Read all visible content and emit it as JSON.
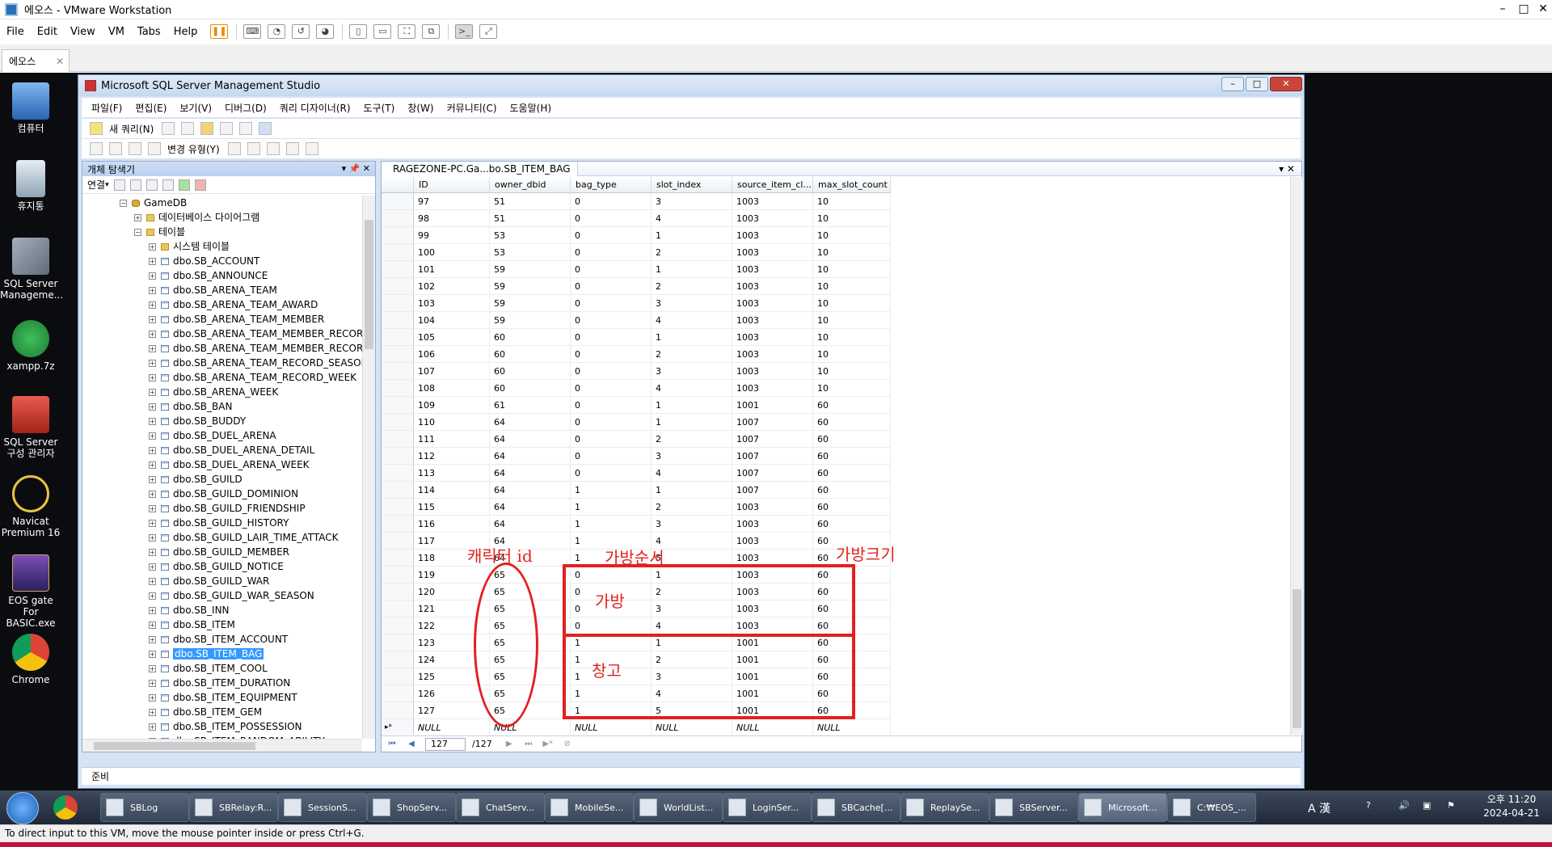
{
  "vm": {
    "title": "에오스 - VMware Workstation",
    "menu": [
      "File",
      "Edit",
      "View",
      "VM",
      "Tabs",
      "Help"
    ],
    "tab_label": "에오스",
    "status_text": "To direct input to this VM, move the mouse pointer inside or press Ctrl+G."
  },
  "desktop_icons": [
    "컴퓨터",
    "휴지통",
    "SQL Server Manageme...",
    "xampp.7z",
    "SQL Server 구성 관리자",
    "Navicat Premium 16",
    "EOS gate For BASIC.exe ...",
    "Chrome"
  ],
  "ssms": {
    "title": "Microsoft SQL Server Management Studio",
    "menu": [
      "파일(F)",
      "편집(E)",
      "보기(V)",
      "디버그(D)",
      "쿼리 디자이너(R)",
      "도구(T)",
      "창(W)",
      "커뮤니티(C)",
      "도움말(H)"
    ],
    "new_query": "새 쿼리(N)",
    "change_type": "변경 유형(Y)",
    "status": "준비"
  },
  "object_explorer": {
    "title": "개체 탐색기",
    "connect": "연결",
    "db_name": "GameDB",
    "diagrams": "데이터베이스 다이어그램",
    "tables_folder": "테이블",
    "system_tables": "시스템 테이블",
    "tables": [
      "dbo.SB_ACCOUNT",
      "dbo.SB_ANNOUNCE",
      "dbo.SB_ARENA_TEAM",
      "dbo.SB_ARENA_TEAM_AWARD",
      "dbo.SB_ARENA_TEAM_MEMBER",
      "dbo.SB_ARENA_TEAM_MEMBER_RECORD",
      "dbo.SB_ARENA_TEAM_MEMBER_RECORD",
      "dbo.SB_ARENA_TEAM_RECORD_SEASON",
      "dbo.SB_ARENA_TEAM_RECORD_WEEK",
      "dbo.SB_ARENA_WEEK",
      "dbo.SB_BAN",
      "dbo.SB_BUDDY",
      "dbo.SB_DUEL_ARENA",
      "dbo.SB_DUEL_ARENA_DETAIL",
      "dbo.SB_DUEL_ARENA_WEEK",
      "dbo.SB_GUILD",
      "dbo.SB_GUILD_DOMINION",
      "dbo.SB_GUILD_FRIENDSHIP",
      "dbo.SB_GUILD_HISTORY",
      "dbo.SB_GUILD_LAIR_TIME_ATTACK",
      "dbo.SB_GUILD_MEMBER",
      "dbo.SB_GUILD_NOTICE",
      "dbo.SB_GUILD_WAR",
      "dbo.SB_GUILD_WAR_SEASON",
      "dbo.SB_INN",
      "dbo.SB_ITEM",
      "dbo.SB_ITEM_ACCOUNT",
      "dbo.SB_ITEM_BAG",
      "dbo.SB_ITEM_COOL",
      "dbo.SB_ITEM_DURATION",
      "dbo.SB_ITEM_EQUIPMENT",
      "dbo.SB_ITEM_GEM",
      "dbo.SB_ITEM_POSSESSION",
      "dbo.SB_ITEM_RANDOM_ABILITY"
    ],
    "selected_table": "dbo.SB_ITEM_BAG"
  },
  "result": {
    "tab_title": "RAGEZONE-PC.Ga...bo.SB_ITEM_BAG",
    "columns": [
      "ID",
      "owner_dbid",
      "bag_type",
      "slot_index",
      "source_item_cl...",
      "max_slot_count"
    ],
    "rows": [
      [
        "97",
        "51",
        "0",
        "3",
        "1003",
        "10"
      ],
      [
        "98",
        "51",
        "0",
        "4",
        "1003",
        "10"
      ],
      [
        "99",
        "53",
        "0",
        "1",
        "1003",
        "10"
      ],
      [
        "100",
        "53",
        "0",
        "2",
        "1003",
        "10"
      ],
      [
        "101",
        "59",
        "0",
        "1",
        "1003",
        "10"
      ],
      [
        "102",
        "59",
        "0",
        "2",
        "1003",
        "10"
      ],
      [
        "103",
        "59",
        "0",
        "3",
        "1003",
        "10"
      ],
      [
        "104",
        "59",
        "0",
        "4",
        "1003",
        "10"
      ],
      [
        "105",
        "60",
        "0",
        "1",
        "1003",
        "10"
      ],
      [
        "106",
        "60",
        "0",
        "2",
        "1003",
        "10"
      ],
      [
        "107",
        "60",
        "0",
        "3",
        "1003",
        "10"
      ],
      [
        "108",
        "60",
        "0",
        "4",
        "1003",
        "10"
      ],
      [
        "109",
        "61",
        "0",
        "1",
        "1001",
        "60"
      ],
      [
        "110",
        "64",
        "0",
        "1",
        "1007",
        "60"
      ],
      [
        "111",
        "64",
        "0",
        "2",
        "1007",
        "60"
      ],
      [
        "112",
        "64",
        "0",
        "3",
        "1007",
        "60"
      ],
      [
        "113",
        "64",
        "0",
        "4",
        "1007",
        "60"
      ],
      [
        "114",
        "64",
        "1",
        "1",
        "1007",
        "60"
      ],
      [
        "115",
        "64",
        "1",
        "2",
        "1003",
        "60"
      ],
      [
        "116",
        "64",
        "1",
        "3",
        "1003",
        "60"
      ],
      [
        "117",
        "64",
        "1",
        "4",
        "1003",
        "60"
      ],
      [
        "118",
        "64",
        "1",
        "5",
        "1003",
        "60"
      ],
      [
        "119",
        "65",
        "0",
        "1",
        "1003",
        "60"
      ],
      [
        "120",
        "65",
        "0",
        "2",
        "1003",
        "60"
      ],
      [
        "121",
        "65",
        "0",
        "3",
        "1003",
        "60"
      ],
      [
        "122",
        "65",
        "0",
        "4",
        "1003",
        "60"
      ],
      [
        "123",
        "65",
        "1",
        "1",
        "1001",
        "60"
      ],
      [
        "124",
        "65",
        "1",
        "2",
        "1001",
        "60"
      ],
      [
        "125",
        "65",
        "1",
        "3",
        "1001",
        "60"
      ],
      [
        "126",
        "65",
        "1",
        "4",
        "1001",
        "60"
      ],
      [
        "127",
        "65",
        "1",
        "5",
        "1001",
        "60"
      ]
    ],
    "null_label": "NULL",
    "new_row_marker": "▸*",
    "nav_current": "127",
    "nav_total": "/127"
  },
  "annotations": {
    "char_id": "캐릭터 id",
    "bag_order": "가방순서",
    "bag_size": "가방크기",
    "bag": "가방",
    "storage": "창고"
  },
  "taskbar": {
    "items": [
      "SBLog",
      "SBRelay:R...",
      "SessionS...",
      "ShopServ...",
      "ChatServ...",
      "MobileSe...",
      "WorldList...",
      "LoginSer...",
      "SBCache[...",
      "ReplaySe...",
      "SBServer...",
      "Microsoft...",
      "C:₩EOS_..."
    ],
    "clock_time": "오후 11:20",
    "clock_date": "2024-04-21",
    "ime": "A 漢"
  },
  "colors": {
    "annotation": "#e32020",
    "selection": "#3399ff",
    "vm_bottom": "#c0153a"
  }
}
